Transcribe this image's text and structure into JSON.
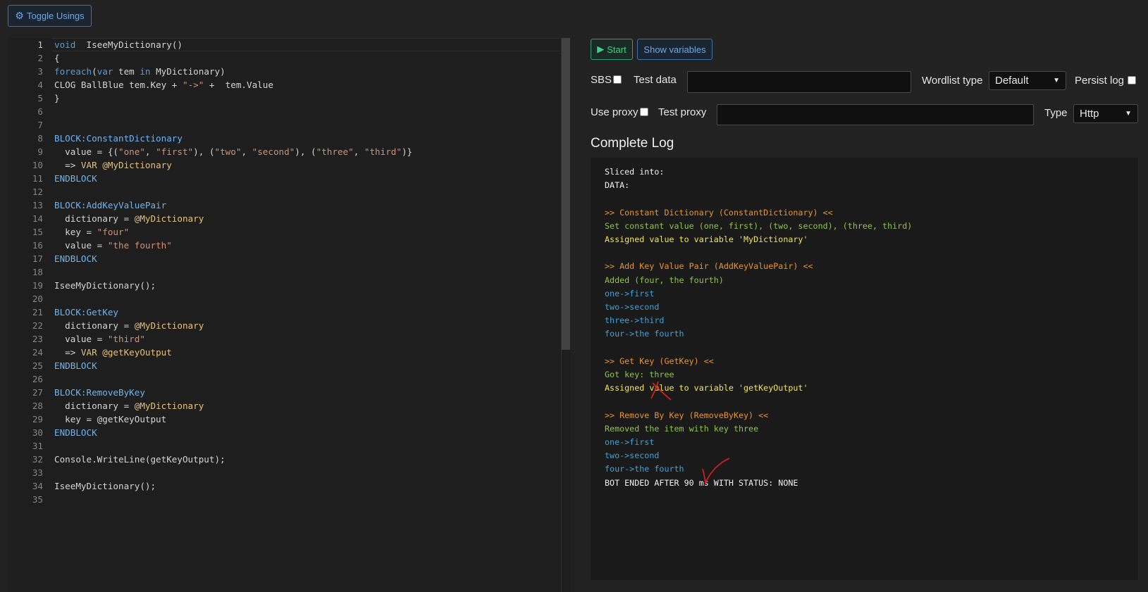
{
  "toolbar": {
    "toggle_usings_label": "Toggle Usings",
    "gear_icon": "gear-icon"
  },
  "editor": {
    "line_numbers": [
      "1",
      "2",
      "3",
      "4",
      "5",
      "6",
      "7",
      "8",
      "9",
      "10",
      "11",
      "12",
      "13",
      "14",
      "15",
      "16",
      "17",
      "18",
      "19",
      "20",
      "21",
      "22",
      "23",
      "24",
      "25",
      "26",
      "27",
      "28",
      "29",
      "30",
      "31",
      "32",
      "33",
      "34",
      "35"
    ],
    "lines": [
      [
        [
          "kw",
          "void"
        ],
        [
          "",
          "  IseeMyDictionary()"
        ]
      ],
      [
        [
          "",
          "{"
        ]
      ],
      [
        [
          "kw",
          "foreach"
        ],
        [
          "",
          "("
        ],
        [
          "kw",
          "var"
        ],
        [
          "",
          " tem "
        ],
        [
          "kw",
          "in"
        ],
        [
          "",
          " MyDictionary)"
        ]
      ],
      [
        [
          "",
          "CLOG BallBlue tem.Key + "
        ],
        [
          "str",
          "\"->\""
        ],
        [
          "",
          " +  tem.Value"
        ]
      ],
      [
        [
          "",
          "}"
        ]
      ],
      [],
      [],
      [
        [
          "blk",
          "BLOCK:ConstantDictionary"
        ]
      ],
      [
        [
          "",
          "  value = {("
        ],
        [
          "str",
          "\"one\""
        ],
        [
          "",
          ", "
        ],
        [
          "str",
          "\"first\""
        ],
        [
          "",
          "), ("
        ],
        [
          "str",
          "\"two\""
        ],
        [
          "",
          ", "
        ],
        [
          "str",
          "\"second\""
        ],
        [
          "",
          "), ("
        ],
        [
          "str",
          "\"three\""
        ],
        [
          "",
          ", "
        ],
        [
          "str",
          "\"third\""
        ],
        [
          "",
          ")}"
        ]
      ],
      [
        [
          "",
          "  => "
        ],
        [
          "vd",
          "VAR @MyDictionary"
        ]
      ],
      [
        [
          "blk",
          "ENDBLOCK"
        ]
      ],
      [],
      [
        [
          "blk",
          "BLOCK:AddKeyValuePair"
        ]
      ],
      [
        [
          "",
          "  dictionary = "
        ],
        [
          "vd",
          "@MyDictionary"
        ]
      ],
      [
        [
          "",
          "  key = "
        ],
        [
          "str",
          "\"four\""
        ]
      ],
      [
        [
          "",
          "  value = "
        ],
        [
          "str",
          "\"the fourth\""
        ]
      ],
      [
        [
          "blk",
          "ENDBLOCK"
        ]
      ],
      [],
      [
        [
          "",
          "IseeMyDictionary();"
        ]
      ],
      [],
      [
        [
          "blk",
          "BLOCK:GetKey"
        ]
      ],
      [
        [
          "",
          "  dictionary = "
        ],
        [
          "vd",
          "@MyDictionary"
        ]
      ],
      [
        [
          "",
          "  value = "
        ],
        [
          "str",
          "\"third\""
        ]
      ],
      [
        [
          "",
          "  => "
        ],
        [
          "vd",
          "VAR @getKeyOutput"
        ]
      ],
      [
        [
          "blk",
          "ENDBLOCK"
        ]
      ],
      [],
      [
        [
          "blk",
          "BLOCK:RemoveByKey"
        ]
      ],
      [
        [
          "",
          "  dictionary = "
        ],
        [
          "vd",
          "@MyDictionary"
        ]
      ],
      [
        [
          "",
          "  key = @getKeyOutput"
        ]
      ],
      [
        [
          "blk",
          "ENDBLOCK"
        ]
      ],
      [],
      [
        [
          "",
          "Console.WriteLine(getKeyOutput);"
        ]
      ],
      [],
      [
        [
          "",
          "IseeMyDictionary();"
        ]
      ],
      []
    ]
  },
  "controls": {
    "start_label": "Start",
    "play_icon": "play-icon",
    "show_variables_label": "Show variables",
    "sbs_label": "SBS",
    "test_data_label": "Test data",
    "test_data_value": "",
    "wordlist_type_label": "Wordlist type",
    "wordlist_type_value": "Default",
    "persist_log_label": "Persist log",
    "use_proxy_label": "Use proxy",
    "test_proxy_label": "Test proxy",
    "test_proxy_value": "",
    "type_label": "Type",
    "type_value": "Http"
  },
  "log": {
    "title": "Complete Log",
    "lines": [
      [
        "white",
        "Sliced into:"
      ],
      [
        "white",
        "DATA:"
      ],
      [
        "white",
        ""
      ],
      [
        "orange",
        ">> Constant Dictionary (ConstantDictionary) <<"
      ],
      [
        "green",
        "Set constant value (one, first), (two, second), (three, third)"
      ],
      [
        "yellow",
        "Assigned value to variable 'MyDictionary'"
      ],
      [
        "white",
        ""
      ],
      [
        "orange",
        ">> Add Key Value Pair (AddKeyValuePair) <<"
      ],
      [
        "green",
        "Added (four, the fourth)"
      ],
      [
        "blue",
        "one->first"
      ],
      [
        "blue",
        "two->second"
      ],
      [
        "blue",
        "three->third"
      ],
      [
        "blue",
        "four->the fourth"
      ],
      [
        "white",
        ""
      ],
      [
        "orange",
        ">> Get Key (GetKey) <<"
      ],
      [
        "green",
        "Got key: three"
      ],
      [
        "yellow",
        "Assigned value to variable 'getKeyOutput'"
      ],
      [
        "white",
        ""
      ],
      [
        "orange",
        ">> Remove By Key (RemoveByKey) <<"
      ],
      [
        "green",
        "Removed the item with key three"
      ],
      [
        "blue",
        "one->first"
      ],
      [
        "blue",
        "two->second"
      ],
      [
        "blue",
        "four->the fourth"
      ],
      [
        "white",
        "BOT ENDED AFTER 90 ms WITH STATUS: NONE"
      ]
    ]
  },
  "annotations": {
    "cross_mark": "red-cross-annotation",
    "check_mark": "red-checkmark-annotation",
    "color": "#e02020"
  }
}
